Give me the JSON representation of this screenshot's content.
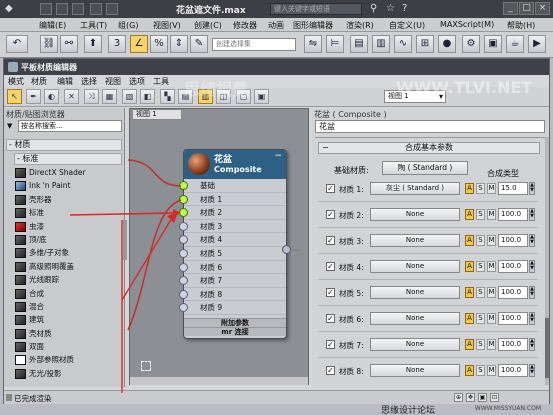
{
  "max_window": {
    "title": "花盆遮文件.max",
    "search_placeholder": "键入关键字或短语",
    "menu": [
      "编辑(E)",
      "工具(T)",
      "组(G)",
      "视图(V)",
      "创建(C)",
      "修改器",
      "动画",
      "图形编辑器",
      "渲染(R)",
      "自定义(U)",
      "MAXScript(M)",
      "帮助(H)"
    ],
    "selection_set_placeholder": "创建选择集"
  },
  "editor": {
    "title": "平板材质编辑器",
    "menu": [
      "模式",
      "材质",
      "编辑",
      "选择",
      "视图",
      "选项",
      "工具"
    ],
    "view_dropdown": "视图 1"
  },
  "browser": {
    "header": "材质/贴图浏览器",
    "search_placeholder": "按名称搜索...",
    "group_materials": "- 材质",
    "group_standard": "- 标准",
    "items": [
      {
        "label": "DirectX Shader",
        "swatch": "dark"
      },
      {
        "label": "Ink 'n Paint",
        "swatch": "blue"
      },
      {
        "label": "壳形器",
        "swatch": "dark"
      },
      {
        "label": "标准",
        "swatch": "dark"
      },
      {
        "label": "虫漆",
        "swatch": "red"
      },
      {
        "label": "顶/底",
        "swatch": "dark"
      },
      {
        "label": "多维/子对象",
        "swatch": "dark"
      },
      {
        "label": "高级照明覆盖",
        "swatch": "dark"
      },
      {
        "label": "光线跟踪",
        "swatch": "dark"
      },
      {
        "label": "合成",
        "swatch": "dark"
      },
      {
        "label": "混合",
        "swatch": "dark"
      },
      {
        "label": "建筑",
        "swatch": "dark"
      },
      {
        "label": "壳材质",
        "swatch": "dark"
      },
      {
        "label": "双面",
        "swatch": "dark"
      },
      {
        "label": "外部参照材质",
        "swatch": "white"
      },
      {
        "label": "无光/投影",
        "swatch": "dark"
      }
    ]
  },
  "canvas": {
    "tab_label": "视图 1",
    "node": {
      "name": "花盆",
      "type": "Composite",
      "slots": [
        "基础",
        "材质 1",
        "材质 2",
        "材质 3",
        "材质 4",
        "材质 5",
        "材质 6",
        "材质 7",
        "材质 8",
        "材质 9"
      ],
      "section_extra": "附加参数",
      "section_connect": "mr 连接"
    }
  },
  "params": {
    "header": "花盆 ( Composite )",
    "material_name": "花盆",
    "rollout_title": "合成基本参数",
    "base_material_label": "基础材质:",
    "base_material_value": "陶 ( Standard )",
    "composite_type_label": "合成类型",
    "rows": [
      {
        "label": "材质 1:",
        "value": "灰尘 ( Standard )",
        "amount": "15.0"
      },
      {
        "label": "材质 2:",
        "value": "None",
        "amount": "100.0"
      },
      {
        "label": "材质 3:",
        "value": "None",
        "amount": "100.0"
      },
      {
        "label": "材质 4:",
        "value": "None",
        "amount": "100.0"
      },
      {
        "label": "材质 5:",
        "value": "None",
        "amount": "100.0"
      },
      {
        "label": "材质 6:",
        "value": "None",
        "amount": "100.0"
      },
      {
        "label": "材质 7:",
        "value": "None",
        "amount": "100.0"
      },
      {
        "label": "材质 8:",
        "value": "None",
        "amount": "100.0"
      }
    ],
    "btn_a": "A",
    "btn_s": "S",
    "btn_m": "M"
  },
  "status": {
    "text": "已完成渲染"
  },
  "watermarks": {
    "center": "思绪視覺",
    "url": "WWW.TLVI.NET",
    "footer": "思缘设计论坛",
    "footer_url": "WWW.MISSYUAN.COM"
  },
  "colors": {
    "node_header": "#2e5f84",
    "active_dot": "#bfff3f",
    "arrow": "#d62a2a",
    "toggle_on": "#f3c84a"
  }
}
